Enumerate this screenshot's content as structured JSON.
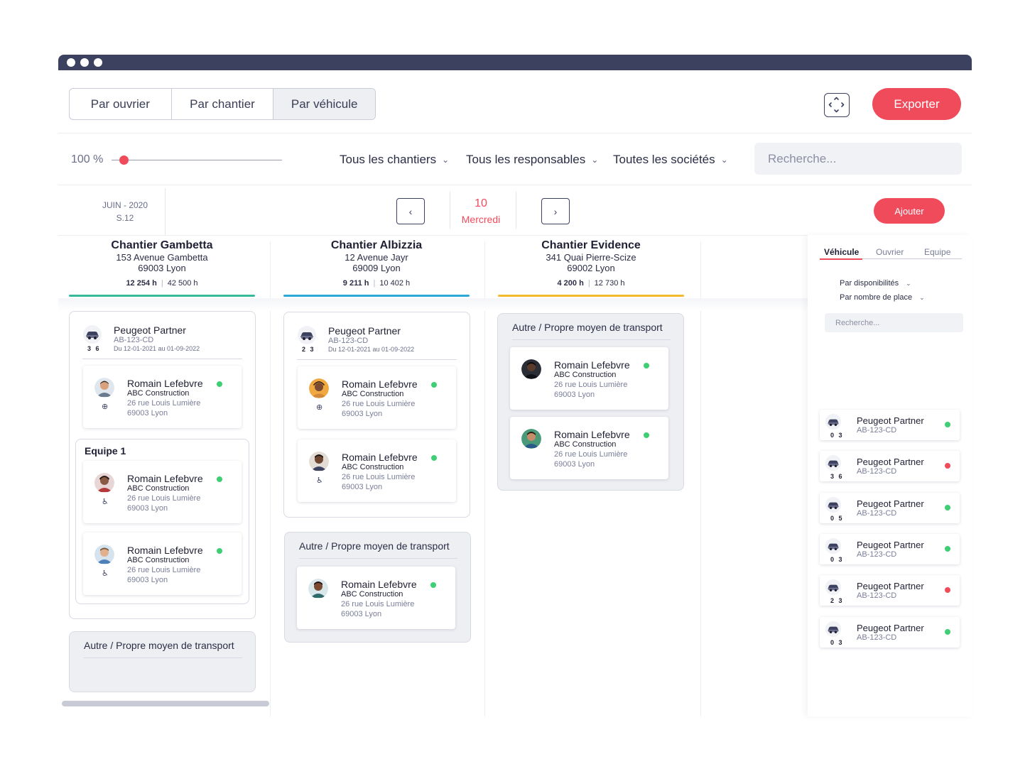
{
  "toolbar": {
    "view_tabs": [
      "Par ouvrier",
      "Par chantier",
      "Par véhicule"
    ],
    "export_label": "Exporter"
  },
  "filters": {
    "zoom": "100 %",
    "zoom_level_percent": 100,
    "chantiers": "Tous les chantiers",
    "responsables": "Tous les responsables",
    "societes": "Toutes les sociétés",
    "search_placeholder": "Recherche..."
  },
  "calendar": {
    "month": "JUIN - 2020",
    "week": "S.12",
    "day_number": "10",
    "day_name": "Mercredi",
    "prev_icon": "‹",
    "next_icon": "›",
    "add_label": "Ajouter"
  },
  "worker_common": {
    "name": "Romain Lefebvre",
    "company": "ABC Construction",
    "street": "26 rue Louis Lumière",
    "city": "69003 Lyon"
  },
  "vehicle_common": {
    "name": "Peugeot Partner",
    "plate": "AB-123-CD",
    "dates": "Du 12-01-2021 au 01-09-2022"
  },
  "other_transport": "Autre / Propre moyen de transport",
  "columns": [
    {
      "title": "Chantier Gambetta",
      "street": "153 Avenue Gambetta",
      "city": "69003 Lyon",
      "hours_done": "12 254 h",
      "hours_total": "42 500 h",
      "color": "#36b99a",
      "vehicle_count": "3 6",
      "team_label": "Equipe 1"
    },
    {
      "title": "Chantier Albizzia",
      "street": "12 Avenue Jayr",
      "city": "69009 Lyon",
      "hours_done": "9 211 h",
      "hours_total": "10 402 h",
      "color": "#2aa8d6",
      "vehicle_count": "2 3"
    },
    {
      "title": "Chantier Evidence",
      "street": "341 Quai Pierre-Scize",
      "city": "69002 Lyon",
      "hours_done": "4 200 h",
      "hours_total": "12 730 h",
      "color": "#f3b92f"
    }
  ],
  "sidebar": {
    "tabs": [
      "Véhicule",
      "Ouvrier",
      "Equipe"
    ],
    "sort_availability": "Par disponibilités",
    "sort_seats": "Par nombre de place",
    "search_placeholder": "Recherche...",
    "vehicles": [
      {
        "name": "Peugeot Partner",
        "plate": "AB-123-CD",
        "count": "0 3",
        "status": "#3ecf74"
      },
      {
        "name": "Peugeot Partner",
        "plate": "AB-123-CD",
        "count": "3 6",
        "status": "#f04b5b"
      },
      {
        "name": "Peugeot Partner",
        "plate": "AB-123-CD",
        "count": "0 5",
        "status": "#3ecf74"
      },
      {
        "name": "Peugeot Partner",
        "plate": "AB-123-CD",
        "count": "0 3",
        "status": "#3ecf74"
      },
      {
        "name": "Peugeot Partner",
        "plate": "AB-123-CD",
        "count": "2 3",
        "status": "#f04b5b"
      },
      {
        "name": "Peugeot Partner",
        "plate": "AB-123-CD",
        "count": "0 3",
        "status": "#3ecf74"
      }
    ]
  },
  "colors": {
    "accent": "#f04b5b",
    "titlebar": "#3c4160",
    "available": "#3ecf74"
  },
  "icons": {
    "driver": "⊕",
    "passenger": "♿︎"
  }
}
